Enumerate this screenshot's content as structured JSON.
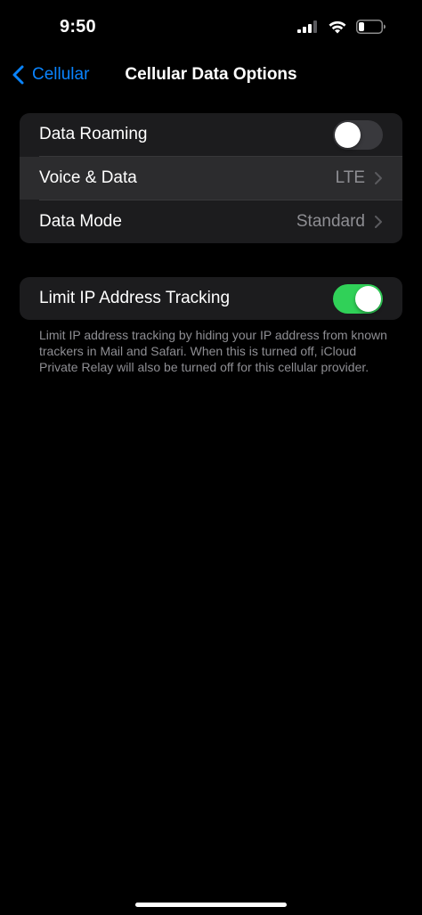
{
  "status_bar": {
    "time": "9:50",
    "signal_icon": "cellular-signal-icon",
    "wifi_icon": "wifi-icon",
    "battery_icon": "battery-low-icon"
  },
  "nav": {
    "back_label": "Cellular",
    "title": "Cellular Data Options"
  },
  "group1": {
    "data_roaming": {
      "label": "Data Roaming",
      "toggle": false
    },
    "voice_data": {
      "label": "Voice & Data",
      "value": "LTE"
    },
    "data_mode": {
      "label": "Data Mode",
      "value": "Standard"
    }
  },
  "group2": {
    "limit_ip": {
      "label": "Limit IP Address Tracking",
      "toggle": true
    }
  },
  "footnote": "Limit IP address tracking by hiding your IP address from known trackers in Mail and Safari. When this is turned off, iCloud Private Relay will also be turned off for this cellular provider.",
  "colors": {
    "accent": "#0a84ff",
    "toggle_on": "#30d158",
    "toggle_off": "#39393d",
    "group_bg": "#1c1c1e",
    "secondary_text": "#8e8e93"
  }
}
